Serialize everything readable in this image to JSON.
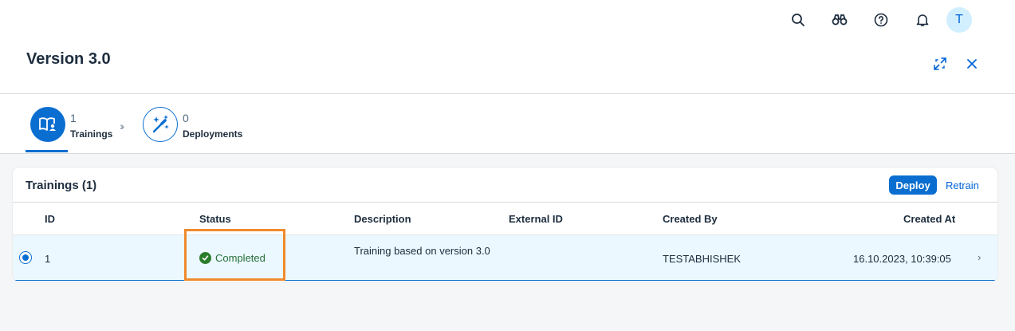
{
  "shellbar": {
    "icons": [
      "search-icon",
      "binoculars-icon",
      "help-icon",
      "notification-bell-icon"
    ],
    "avatar_initial": "T"
  },
  "header": {
    "title": "Version 3.0",
    "actions": [
      "fullscreen-icon",
      "close-icon"
    ]
  },
  "steps": [
    {
      "count": "1",
      "label": "Trainings",
      "icon": "training-book-icon",
      "active": true
    },
    {
      "count": "0",
      "label": "Deployments",
      "icon": "magic-wand-icon",
      "active": false
    }
  ],
  "trainings": {
    "title": "Trainings (1)",
    "deploy_label": "Deploy",
    "retrain_label": "Retrain",
    "columns": [
      "ID",
      "Status",
      "Description",
      "External ID",
      "Created By",
      "Created At"
    ],
    "rows": [
      {
        "id": "1",
        "status": "Completed",
        "description": "Training based on version 3.0",
        "external_id": "",
        "created_by": "TESTABHISHEK",
        "created_at": "16.10.2023, 10:39:05",
        "selected": true
      }
    ]
  },
  "colors": {
    "accent": "#0a6ed1",
    "success": "#2b7c2b",
    "highlight_box": "#f08a2c",
    "selected_row": "#ebf8ff"
  }
}
